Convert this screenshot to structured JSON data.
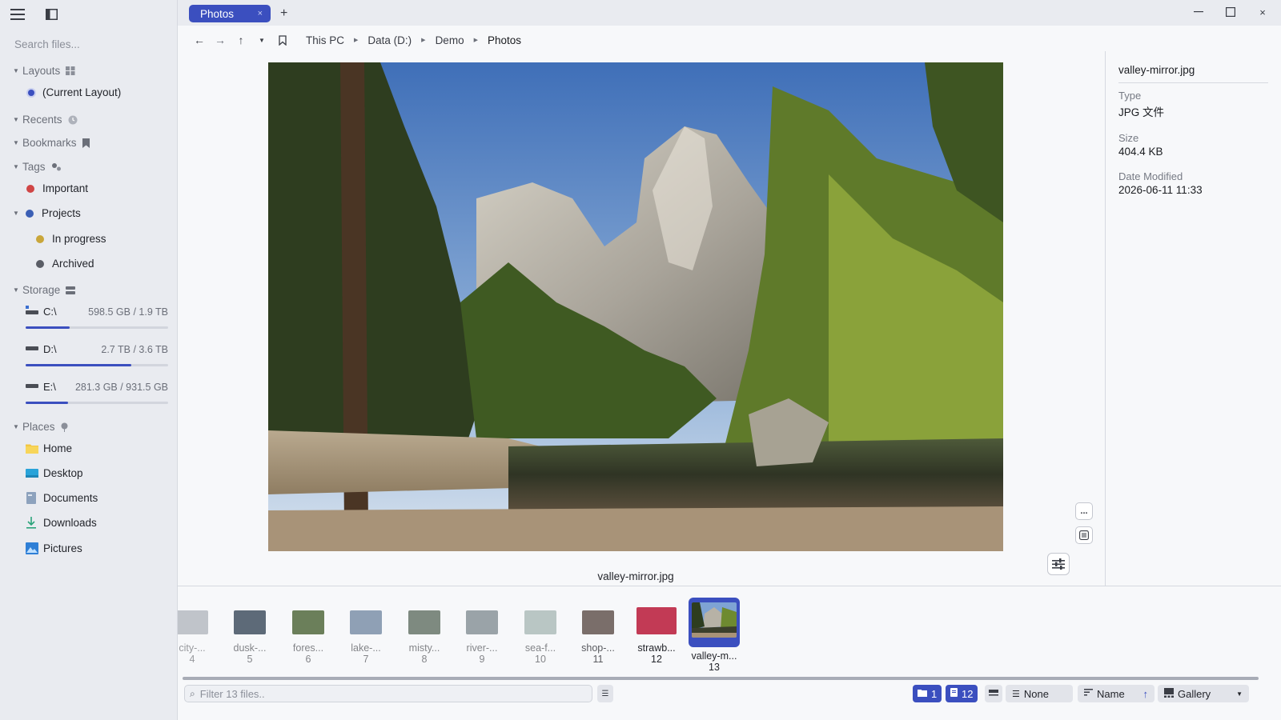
{
  "sidebar": {
    "search_placeholder": "Search files...",
    "layouts": {
      "label": "Layouts",
      "items": [
        "(Current Layout)"
      ]
    },
    "recents": {
      "label": "Recents"
    },
    "bookmarks": {
      "label": "Bookmarks"
    },
    "tags": {
      "label": "Tags",
      "items": [
        {
          "label": "Important",
          "color": "#d04545"
        },
        {
          "label": "Projects",
          "color": "#3b5fb5"
        },
        {
          "label": "In progress",
          "color": "#c9a63a"
        },
        {
          "label": "Archived",
          "color": "#5a5d66"
        }
      ]
    },
    "storage": {
      "label": "Storage",
      "drives": [
        {
          "name": "C:\\",
          "size": "598.5 GB / 1.9 TB",
          "used": 0.31
        },
        {
          "name": "D:\\",
          "size": "2.7 TB / 3.6 TB",
          "used": 0.74
        },
        {
          "name": "E:\\",
          "size": "281.3 GB / 931.5 GB",
          "used": 0.3
        }
      ]
    },
    "places": {
      "label": "Places",
      "items": [
        "Home",
        "Desktop",
        "Documents",
        "Downloads",
        "Pictures"
      ]
    }
  },
  "tabs": [
    {
      "label": "Photos",
      "close": "×"
    }
  ],
  "new_tab": "+",
  "window_controls": {
    "minimize": "—",
    "maximize": "☐",
    "close": "×"
  },
  "breadcrumb": [
    "This PC",
    "Data (D:)",
    "Demo",
    "Photos"
  ],
  "preview": {
    "caption": "valley-mirror.jpg",
    "more": "..."
  },
  "details": {
    "filename": "valley-mirror.jpg",
    "type_label": "Type",
    "type_value": "JPG 文件",
    "size_label": "Size",
    "size_value": "404.4 KB",
    "modified_label": "Date Modified",
    "modified_value": "2026-06-11 11:33"
  },
  "thumbnails": [
    {
      "name": "city-...",
      "num": "4",
      "color": "#8a9099"
    },
    {
      "name": "dusk-...",
      "num": "5",
      "color": "#5d6a78"
    },
    {
      "name": "fores...",
      "num": "6",
      "color": "#6b7f5a"
    },
    {
      "name": "lake-...",
      "num": "7",
      "color": "#8fa0b5"
    },
    {
      "name": "misty...",
      "num": "8",
      "color": "#7e8a80"
    },
    {
      "name": "river-...",
      "num": "9",
      "color": "#9aa3a8"
    },
    {
      "name": "sea-f...",
      "num": "10",
      "color": "#b9c6c4"
    },
    {
      "name": "shop-...",
      "num": "11",
      "color": "#7a6e6a"
    },
    {
      "name": "strawb...",
      "num": "12",
      "color": "#c23a55"
    },
    {
      "name": "valley-m...",
      "num": "13",
      "color": "#4b6a3a"
    }
  ],
  "statusbar": {
    "filter_placeholder": "Filter 13 files..",
    "folders_count": "1",
    "files_count": "12",
    "group_by": "None",
    "sort_by": "Name",
    "sort_dir": "↑",
    "view_mode": "Gallery"
  },
  "colors": {
    "accent": "#3b4fbf",
    "sidebar_bg": "#e9ebf0",
    "main_bg": "#f7f8fa"
  }
}
